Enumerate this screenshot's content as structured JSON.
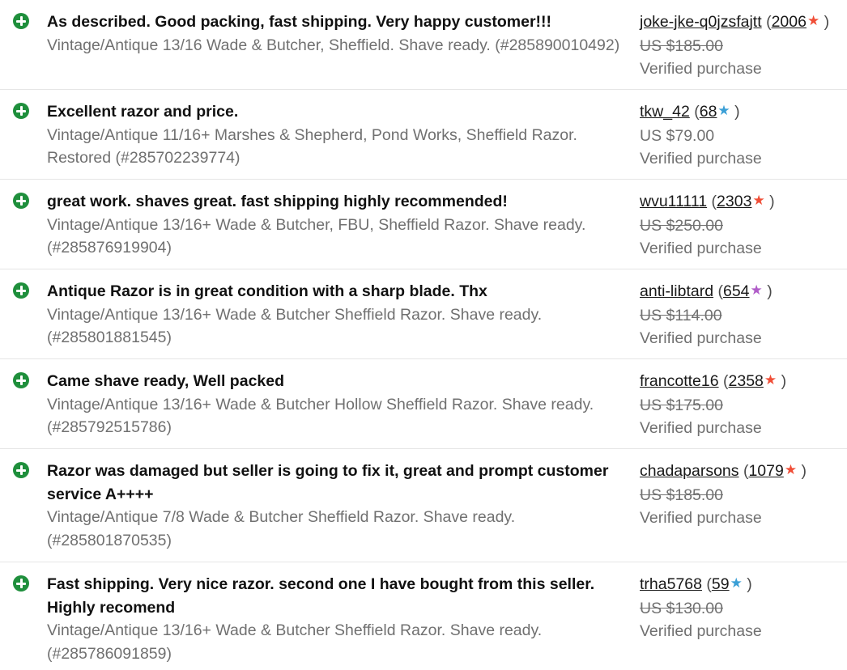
{
  "feedback": [
    {
      "comment": "As described. Good packing, fast shipping. Very happy customer!!!",
      "item": "Vintage/Antique 13/16 Wade & Butcher, Sheffield. Shave ready. (#285890010492)",
      "user": "joke-jke-q0jzsfajtt",
      "score": "2006",
      "star_color": "#f04e37",
      "price": "US $185.00",
      "price_strikethrough": true,
      "verified": "Verified purchase"
    },
    {
      "comment": "Excellent razor and price.",
      "item": "Vintage/Antique 11/16+ Marshes & Shepherd, Pond Works, Sheffield Razor. Restored (#285702239774)",
      "user": "tkw_42",
      "score": "68",
      "star_color": "#3a9fd6",
      "price": "US $79.00",
      "price_strikethrough": false,
      "verified": "Verified purchase"
    },
    {
      "comment": "great work. shaves great. fast shipping highly recommended!",
      "item": "Vintage/Antique 13/16+ Wade & Butcher, FBU, Sheffield Razor. Shave ready. (#285876919904)",
      "user": "wvu11111",
      "score": "2303",
      "star_color": "#f04e37",
      "price": "US $250.00",
      "price_strikethrough": true,
      "verified": "Verified purchase"
    },
    {
      "comment": "Antique Razor is in great condition with a sharp blade. Thx",
      "item": "Vintage/Antique 13/16+ Wade & Butcher Sheffield Razor. Shave ready. (#285801881545)",
      "user": "anti-libtard",
      "score": "654",
      "star_color": "#b05cc8",
      "price": "US $114.00",
      "price_strikethrough": true,
      "verified": "Verified purchase"
    },
    {
      "comment": "Came shave ready, Well packed",
      "item": "Vintage/Antique 13/16+ Wade & Butcher Hollow Sheffield Razor. Shave ready. (#285792515786)",
      "user": "francotte16",
      "score": "2358",
      "star_color": "#f04e37",
      "price": "US $175.00",
      "price_strikethrough": true,
      "verified": "Verified purchase"
    },
    {
      "comment": "Razor was damaged but seller is going to fix it, great and prompt customer service A++++",
      "item": "Vintage/Antique 7/8 Wade & Butcher Sheffield Razor. Shave ready. (#285801870535)",
      "user": "chadaparsons",
      "score": "1079",
      "star_color": "#f04e37",
      "price": "US $185.00",
      "price_strikethrough": true,
      "verified": "Verified purchase"
    },
    {
      "comment": "Fast shipping. Very nice razor. second one I have bought from this seller. Highly recomend",
      "item": "Vintage/Antique 13/16+ Wade & Butcher Sheffield Razor. Shave ready. (#285786091859)",
      "user": "trha5768",
      "score": "59",
      "star_color": "#3a9fd6",
      "price": "US $130.00",
      "price_strikethrough": true,
      "verified": "Verified purchase"
    }
  ],
  "glyphs": {
    "paren_open": "(",
    "paren_close": ")",
    "star": "★"
  },
  "icons": {
    "positive": "positive-feedback-icon"
  },
  "colors": {
    "positive_icon": "#1f8f3c",
    "muted_text": "#707070",
    "divider": "#e5e5e5"
  }
}
